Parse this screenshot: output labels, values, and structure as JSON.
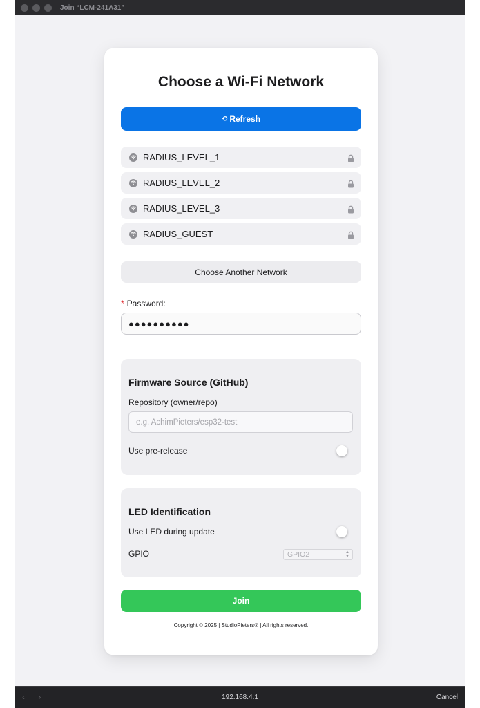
{
  "window": {
    "title": "Join “LCM-241A31”"
  },
  "page": {
    "title": "Choose a Wi-Fi Network",
    "refresh_icon": "⟲",
    "refresh_label": "Refresh",
    "networks": [
      {
        "name": "RADIUS_LEVEL_1",
        "icon": "wifi-icon",
        "secured": true
      },
      {
        "name": "RADIUS_LEVEL_2",
        "icon": "wifi-icon",
        "secured": true
      },
      {
        "name": "RADIUS_LEVEL_3",
        "icon": "wifi-icon",
        "secured": true
      },
      {
        "name": "RADIUS_GUEST",
        "icon": "wifi-icon",
        "secured": true
      }
    ],
    "other_network_label": "Choose Another Network",
    "password": {
      "required_mark": "*",
      "label": "Password:",
      "value": "●●●●●●●●●●"
    },
    "firmware": {
      "title": "Firmware Source (GitHub)",
      "repo_label": "Repository (owner/repo)",
      "repo_placeholder": "e.g. AchimPieters/esp32-test",
      "prerelease_label": "Use pre-release",
      "prerelease_enabled": false
    },
    "led": {
      "title": "LED Identification",
      "use_led_label": "Use LED during update",
      "use_led_enabled": false,
      "gpio_label": "GPIO",
      "gpio_selected": "GPIO2"
    },
    "join_label": "Join",
    "copyright": "Copyright © 2025 | StudioPieters® | All rights reserved."
  },
  "browser": {
    "address": "192.168.4.1",
    "cancel_label": "Cancel"
  },
  "colors": {
    "accent": "#0a74e6",
    "join": "#34c759",
    "required": "#e0282e"
  }
}
